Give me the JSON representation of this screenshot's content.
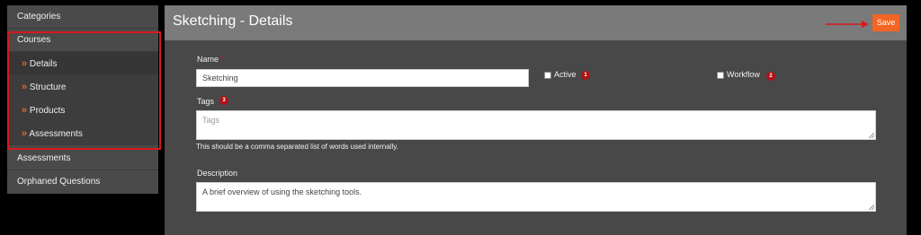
{
  "sidebar": {
    "items": [
      {
        "label": "Categories"
      },
      {
        "label": "Courses"
      },
      {
        "label": "Details"
      },
      {
        "label": "Structure"
      },
      {
        "label": "Products"
      },
      {
        "label": "Assessments"
      },
      {
        "label": "Assessments"
      },
      {
        "label": "Orphaned Questions"
      }
    ],
    "chevron": "»"
  },
  "header": {
    "title": "Sketching - Details",
    "save_label": "Save"
  },
  "form": {
    "name_label": "Name",
    "required_marker": "*",
    "name_value": "Sketching",
    "active_label": "Active",
    "active_badge": "1",
    "workflow_label": "Workflow",
    "workflow_badge": "2",
    "tags_label": "Tags",
    "tags_badge": "3",
    "tags_placeholder": "Tags",
    "tags_help": "This should be a comma separated list of words used internally.",
    "description_label": "Description",
    "description_value": "A brief overview of using the sketching tools."
  },
  "colors": {
    "accent": "#f26522",
    "annotation_red": "#d7191f",
    "badge_red": "#b01116"
  },
  "icons": {
    "chevron": "double-chevron-right-icon",
    "arrow": "arrow-right-icon"
  }
}
